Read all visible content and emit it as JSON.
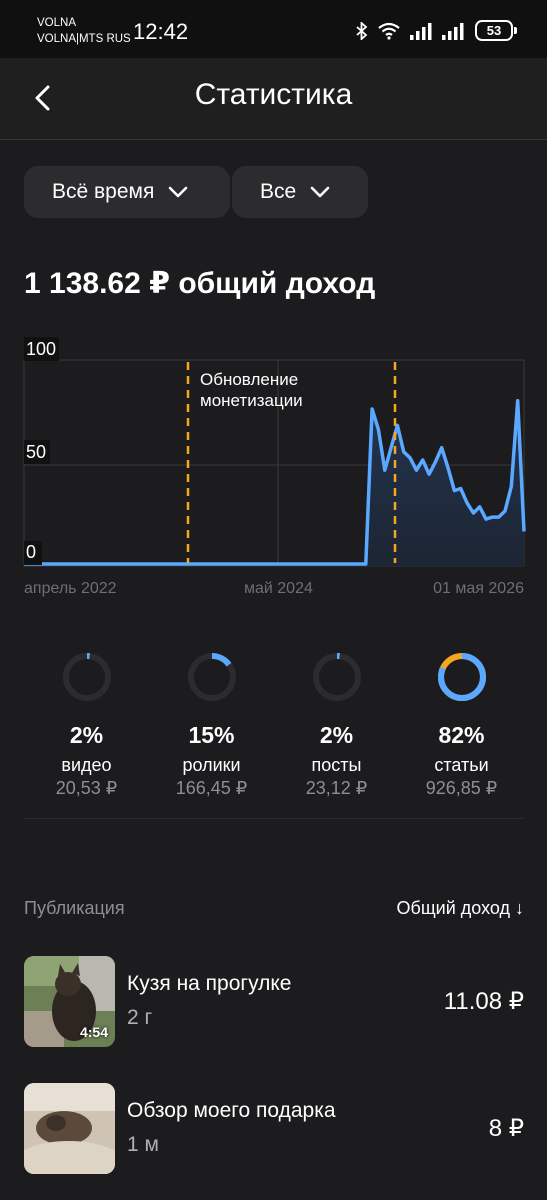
{
  "status_bar": {
    "carrier_line1": "VOLNA",
    "carrier_line2": "VOLNA|MTS RUS",
    "time": "12:42",
    "battery": "53"
  },
  "header": {
    "title": "Статистика",
    "back_icon": "chevron-left-icon"
  },
  "filters": {
    "period": "Всё время",
    "type": "Все"
  },
  "summary": {
    "income_text": "1 138.62 ₽ общий доход"
  },
  "chart_data": {
    "type": "area",
    "y_ticks": [
      "100",
      "50",
      "0"
    ],
    "ylim": [
      0,
      100
    ],
    "x_tick_labels": [
      "апрель 2022",
      "май 2024",
      "01 мая 2026"
    ],
    "annotation": "Обновление монетизации",
    "line_color": "#5aa8ff",
    "marker_color": "#f5a623",
    "values": [
      0,
      0,
      0,
      0,
      0,
      0,
      0,
      0,
      0,
      0,
      0,
      0,
      0,
      0,
      0,
      0,
      0,
      0,
      0,
      0,
      0,
      0,
      0,
      0,
      0,
      0,
      0,
      0,
      0,
      0,
      0,
      0,
      0,
      0,
      0,
      0,
      0,
      0,
      0,
      0,
      0,
      0,
      0,
      0,
      0,
      0,
      0,
      0,
      0,
      0,
      0,
      0,
      0,
      0,
      0,
      76,
      66,
      46,
      57,
      68,
      55,
      52,
      46,
      51,
      44,
      50,
      57,
      47,
      36,
      37,
      30,
      25,
      28,
      22,
      23,
      23,
      26,
      38,
      80,
      16
    ]
  },
  "breakdown": [
    {
      "pct": "2%",
      "label": "видео",
      "amount": "20,53 ₽",
      "fraction": 0.02
    },
    {
      "pct": "15%",
      "label": "ролики",
      "amount": "166,45 ₽",
      "fraction": 0.15
    },
    {
      "pct": "2%",
      "label": "посты",
      "amount": "23,12 ₽",
      "fraction": 0.02
    },
    {
      "pct": "82%",
      "label": "статьи",
      "amount": "926,85 ₽",
      "fraction": 0.82
    }
  ],
  "list": {
    "col_publication": "Публикация",
    "col_income": "Общий доход ↓",
    "items": [
      {
        "title": "Кузя на прогулке",
        "age": "2 г",
        "income": "11.08 ₽",
        "duration": "4:54"
      },
      {
        "title": "Обзор моего подарка",
        "age": "1 м",
        "income": "8 ₽"
      }
    ]
  }
}
